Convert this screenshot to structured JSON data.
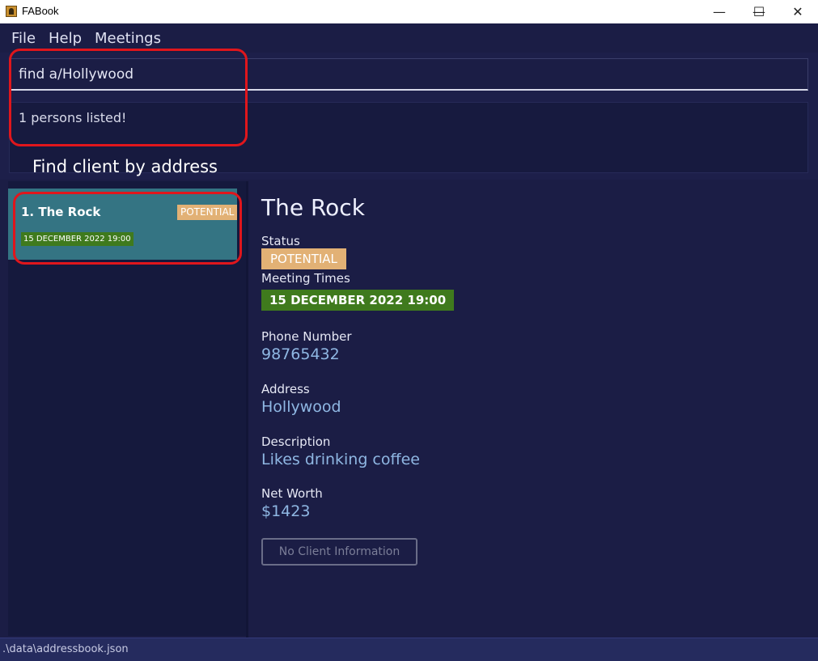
{
  "window": {
    "title": "FABook",
    "app_icon": "app-book-icon",
    "controls": {
      "minimize": "—",
      "maximize": "☐",
      "close": "✕"
    }
  },
  "menu": {
    "items": [
      "File",
      "Help",
      "Meetings"
    ]
  },
  "command": {
    "input_value": "find a/Hollywood"
  },
  "result": {
    "message": "1 persons listed!"
  },
  "annotation": {
    "text": "Find client by address",
    "highlight_color": "#e0161c"
  },
  "person_list": {
    "items": [
      {
        "index_name": "1.  The Rock",
        "status": "POTENTIAL",
        "meeting": "15 DECEMBER 2022 19:00"
      }
    ]
  },
  "details": {
    "name": "The Rock",
    "status_label": "Status",
    "status": "POTENTIAL",
    "meeting_label": "Meeting Times",
    "meeting": "15 DECEMBER 2022 19:00",
    "phone_label": "Phone Number",
    "phone": "98765432",
    "address_label": "Address",
    "address": "Hollywood",
    "description_label": "Description",
    "description": "Likes drinking coffee",
    "networth_label": "Net Worth",
    "networth": "$1423",
    "no_info_button": "No Client Information"
  },
  "status_bar": {
    "path": ".\\data\\addressbook.json"
  },
  "colors": {
    "background": "#1b1d45",
    "card_selected": "#347483",
    "status_potential": "#e2b175",
    "meeting_tag": "#3f7a1d",
    "value_text": "#8fb7e3"
  }
}
